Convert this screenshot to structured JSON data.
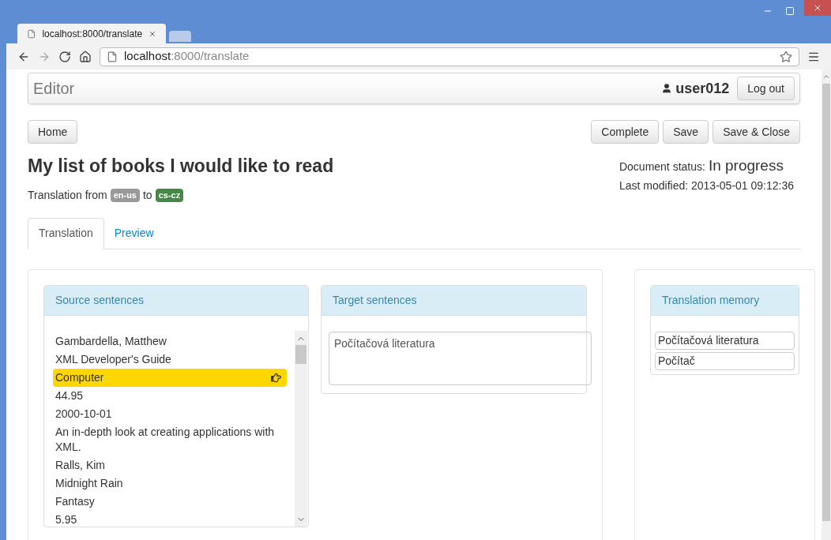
{
  "browser": {
    "tab_title": "localhost:8000/translate",
    "url_host": "localhost",
    "url_rest": ":8000/translate"
  },
  "navbar": {
    "brand": "Editor",
    "user": "user012",
    "logout": "Log out"
  },
  "toolbar": {
    "left": [
      "Home"
    ],
    "right": [
      "Complete",
      "Save",
      "Save & Close"
    ]
  },
  "document": {
    "title": "My list of books I would like to read",
    "translation_prefix": "Translation from",
    "source_lang": "en-us",
    "connector": "to",
    "target_lang": "cs-cz",
    "status_label": "Document status:",
    "status": "In progress",
    "modified": "Last modified: 2013-05-01 09:12:36"
  },
  "tabs": [
    {
      "label": "Translation",
      "selected": true
    },
    {
      "label": "Preview",
      "selected": false
    }
  ],
  "source_panel": {
    "heading": "Source sentences",
    "sentences": [
      {
        "text": "Gambardella, Matthew",
        "selected": false
      },
      {
        "text": "XML Developer's Guide",
        "selected": false
      },
      {
        "text": "Computer",
        "selected": true
      },
      {
        "text": "44.95",
        "selected": false
      },
      {
        "text": "2000-10-01",
        "selected": false
      },
      {
        "text": "An in-depth look at creating applications with XML.",
        "selected": false
      },
      {
        "text": "Ralls, Kim",
        "selected": false
      },
      {
        "text": "Midnight Rain",
        "selected": false
      },
      {
        "text": "Fantasy",
        "selected": false
      },
      {
        "text": "5.95",
        "selected": false
      }
    ]
  },
  "target_panel": {
    "heading": "Target sentences",
    "value": "Počítačová literatura"
  },
  "memory_panel": {
    "heading": "Translation memory",
    "entries": [
      "Počítačová literatura",
      "Počítač"
    ]
  }
}
